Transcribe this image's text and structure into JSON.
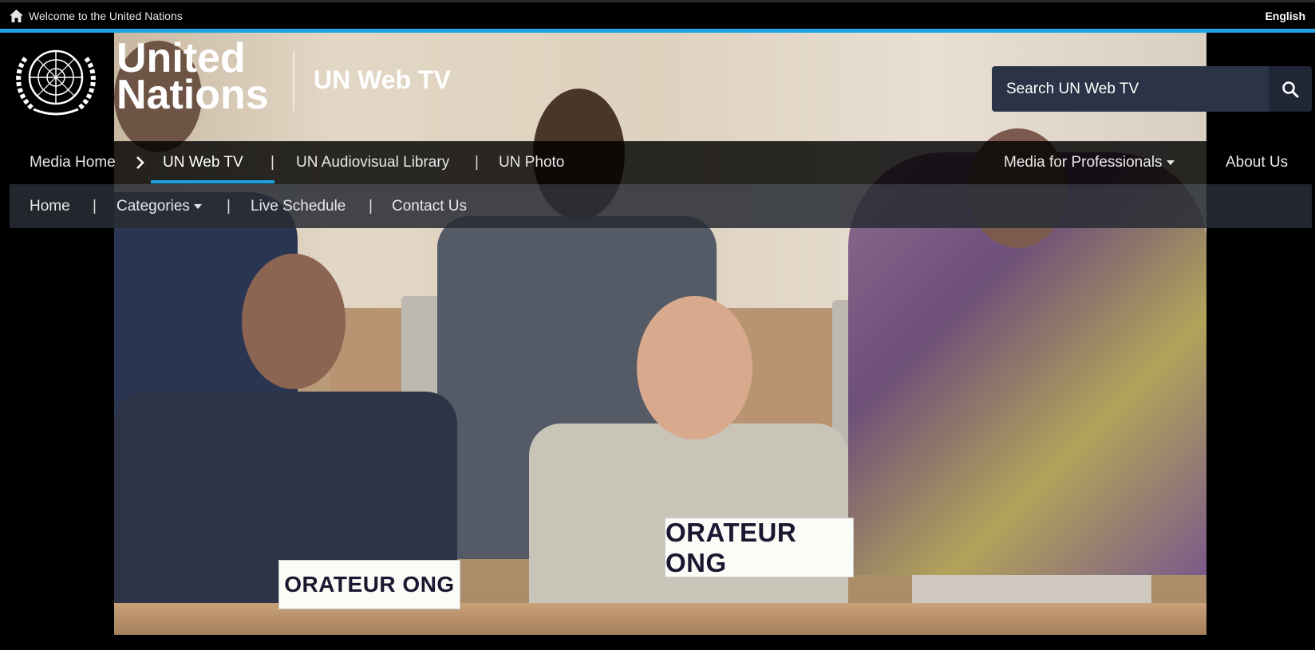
{
  "topbar": {
    "home_icon": "home-icon",
    "welcome_text": "Welcome to the United Nations",
    "language": "English"
  },
  "header": {
    "brand_line1": "United",
    "brand_line2": "Nations",
    "site_name": "UN Web TV",
    "emblem_icon": "un-emblem-icon"
  },
  "search": {
    "placeholder": "Search UN Web TV",
    "icon": "search-icon"
  },
  "nav": {
    "media_home": "Media Home",
    "chevron_icon": "chevron-right-icon",
    "web_tv": "UN Web TV",
    "av_library": "UN Audiovisual Library",
    "photo": "UN Photo",
    "professionals": "Media for Professionals",
    "about": "About Us",
    "separator": "|"
  },
  "subnav": {
    "home": "Home",
    "categories": "Categories",
    "live_schedule": "Live Schedule",
    "contact": "Contact Us",
    "separator": "|"
  },
  "video": {
    "plate_left": "ORATEUR ONG",
    "plate_right": "ORATEUR ONG"
  },
  "colors": {
    "accent_blue": "#1ba3e4",
    "search_bg": "#2b3447"
  }
}
